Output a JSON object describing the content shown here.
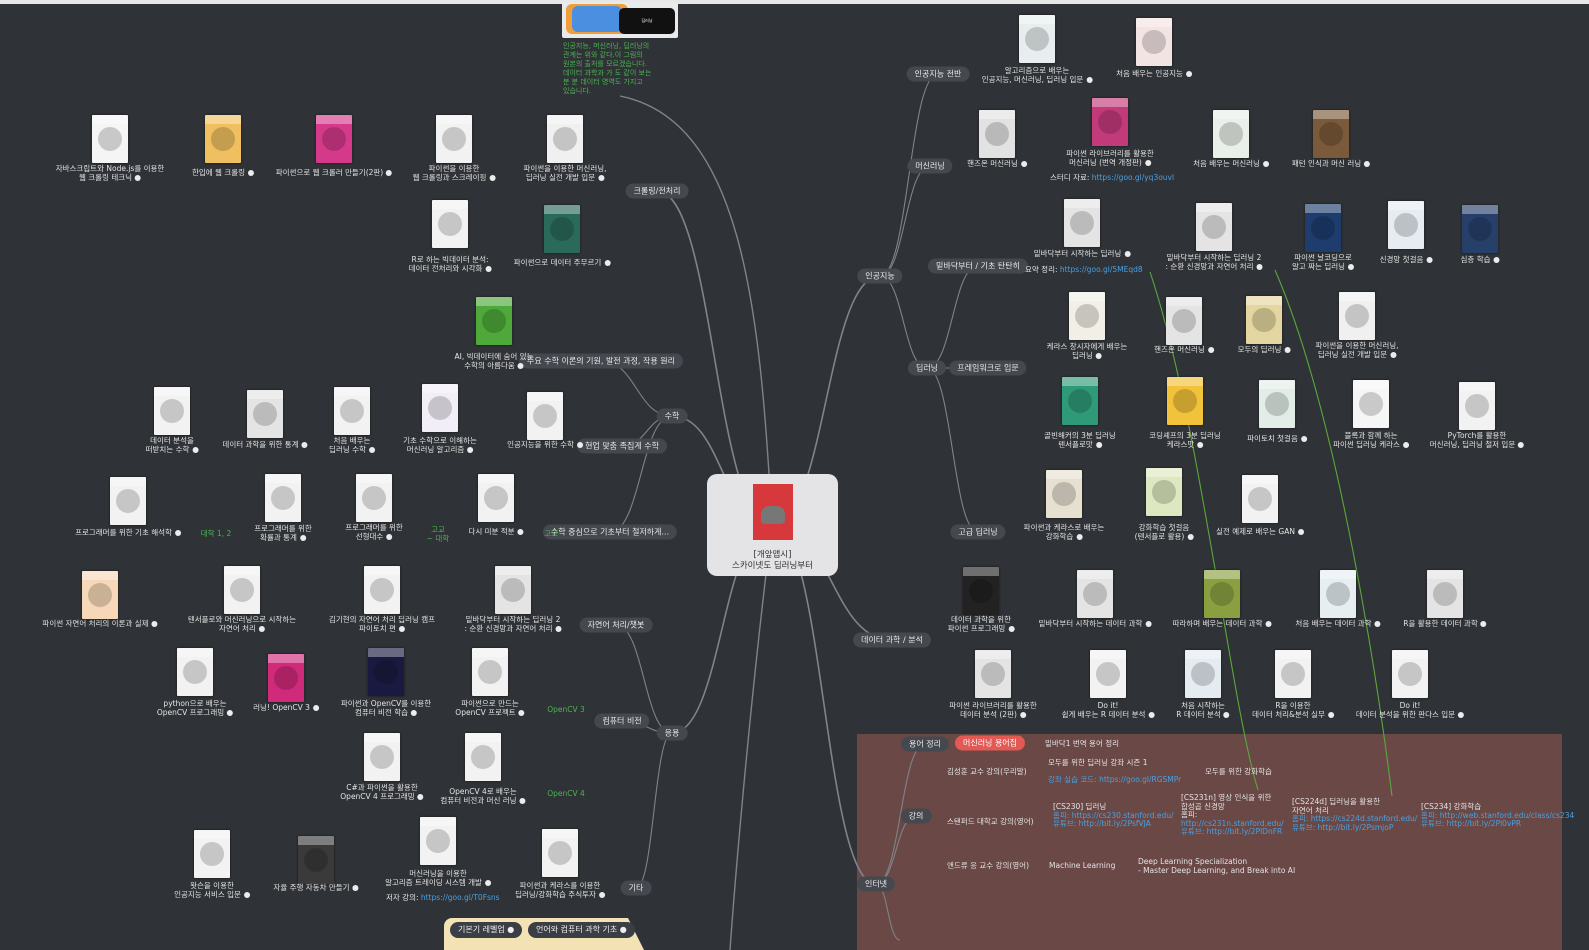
{
  "central": {
    "line1": "[개앞맵시]",
    "line2": "스카이넷도 딥러닝부터"
  },
  "top_note": {
    "image_labels": [
      "인공지능",
      "머신러닝",
      "딥러닝"
    ],
    "text": [
      "인공지능, 머신러닝, 딥러닝의",
      "관계는 위와 같다.이 그림의",
      "원본의 출처를 모르겠습니다.",
      "데이터 과학과 가 도 같이 보는",
      "분 분 데이터 영역도 가지고",
      "있습니다."
    ]
  },
  "branches": [
    {
      "id": "ai",
      "label": "인공지능"
    },
    {
      "id": "ds",
      "label": "데이터 과학 / 분석"
    },
    {
      "id": "internet",
      "label": "인터넷"
    },
    {
      "id": "crawl",
      "label": "크롤링/전처리"
    },
    {
      "id": "math",
      "label": "수학"
    },
    {
      "id": "app",
      "label": "응용"
    }
  ],
  "sub_pills": [
    {
      "label": "인공지능 전반"
    },
    {
      "label": "머신러닝"
    },
    {
      "label": "딥러닝"
    },
    {
      "label": "밑바닥부터 / 기초 탄탄히"
    },
    {
      "label": "프레임워크로 입문"
    },
    {
      "label": "고급 딥러닝"
    },
    {
      "label": "용어 정리"
    },
    {
      "label": "강의"
    },
    {
      "label": "주요 수학 이론의 기원, 발전 과정, 작용 원리"
    },
    {
      "label": "현업 맞춤 족집게 수학"
    },
    {
      "label": "수학 중심으로 기초부터 철저하게..."
    },
    {
      "label": "자연어 처리/챗봇"
    },
    {
      "label": "컴퓨터 비전"
    },
    {
      "label": "기타"
    }
  ],
  "books": [
    {
      "label": "알고리즘으로 배우는\n인공지능, 머신러닝, 딥러닝 입문",
      "color": "#e8eef0"
    },
    {
      "label": "처음 배우는 인공지능",
      "color": "#f3e4e4"
    },
    {
      "label": "핸즈온 머신러닝",
      "color": "#e2e2e2"
    },
    {
      "label": "파이썬 라이브러리를 활용한\n머신러닝 (번역 개정판)",
      "color": "#c23a7a"
    },
    {
      "label": "처음 배우는 머신러닝",
      "color": "#e9f0ea"
    },
    {
      "label": "패턴 인식과 머신 러닝",
      "color": "#7a5a3a"
    },
    {
      "label": "밑바닥부터 시작하는 딥러닝",
      "color": "#e4e4e4"
    },
    {
      "label": "밑바닥부터 시작하는 딥러닝 2\n: 순환 신경망과 자연어 처리",
      "color": "#e4e4e4"
    },
    {
      "label": "파이썬 날코딩으로\n알고 짜는 딥러닝",
      "color": "#1e3c6e"
    },
    {
      "label": "신경망 첫걸음",
      "color": "#e6ecf2"
    },
    {
      "label": "심층 학습",
      "color": "#27406a"
    },
    {
      "label": "케라스 창시자에게 배우는\n딥러닝",
      "color": "#f2f0e6"
    },
    {
      "label": "핸즈온 머신러닝",
      "color": "#e4e4e4"
    },
    {
      "label": "모두의 딥러닝",
      "color": "#e3d6a0"
    },
    {
      "label": "파이썬을 이용한 머신러닝,\n딥러닝 실전 개발 입문",
      "color": "#f0f0f0"
    },
    {
      "label": "골빈해커의 3분 딥러닝\n텐서플로맛",
      "color": "#2e9a78"
    },
    {
      "label": "코딩셰프의 3분 딥러닝\n케라스맛",
      "color": "#f2c23a"
    },
    {
      "label": "파이토치 첫걸음",
      "color": "#e3ede8"
    },
    {
      "label": "블록과 함께 하는\n파이썬 딥러닝 케라스",
      "color": "#f6f6f6"
    },
    {
      "label": "PyTorch를 활용한\n머신러닝, 딥러닝 철저 입문",
      "color": "#f2f2f2"
    },
    {
      "label": "파이썬과 케라스로 배우는\n강화학습",
      "color": "#e6e0d0"
    },
    {
      "label": "강화학습 첫걸음\n(텐서플로 활용)",
      "color": "#dde8c0"
    },
    {
      "label": "실전 예제로 배우는 GAN",
      "color": "#f2f2f2"
    },
    {
      "label": "데이터 과학을 위한\n파이썬 프로그래밍",
      "color": "#222222"
    },
    {
      "label": "밑바닥부터 시작하는 데이터 과학",
      "color": "#e4e4e4"
    },
    {
      "label": "따라하며 배우는 데이터 과학",
      "color": "#8aa040"
    },
    {
      "label": "처음 배우는 데이터 과학",
      "color": "#e6eef2"
    },
    {
      "label": "R을 활용한 데이터 과학",
      "color": "#e4e4e4"
    },
    {
      "label": "파이썬 라이브러리를 활용한\n데이터 분석 (2판)",
      "color": "#e4e4e4"
    },
    {
      "label": "Do it!\n쉽게 배우는 R 데이터 분석",
      "color": "#f2f2f2"
    },
    {
      "label": "처음 시작하는\nR 데이터 분석",
      "color": "#e4ecf2"
    },
    {
      "label": "R을 이용한\n데이터 처리&분석 실무",
      "color": "#f2f2f2"
    },
    {
      "label": "Do it!\n데이터 분석을 위한 판다스 입문",
      "color": "#f2f2f2"
    },
    {
      "label": "자바스크립트와 Node.js를 이용한\n웹 크롤링 테크닉",
      "color": "#f5f5f5"
    },
    {
      "label": "한입에 웹 크롤링",
      "color": "#f0c060"
    },
    {
      "label": "파이썬으로 웹 크롤러 만들기(2판)",
      "color": "#d53a8a"
    },
    {
      "label": "파이썬을 이용한\n웹 크롤링과 스크레이핑",
      "color": "#f2f2f2"
    },
    {
      "label": "파이썬을 이용한 머신러닝,\n딥러닝 실전 개발 입문",
      "color": "#f0f0f0"
    },
    {
      "label": "R로 하는 빅데이터 분석:\n데이터 전처리와 시각화",
      "color": "#f2f2f2"
    },
    {
      "label": "파이썬으로 데이터 주무르기",
      "color": "#2a6a5a"
    },
    {
      "label": "AI, 빅데이터에 숨어 있는\n수학의 아름다움",
      "color": "#4ea83a"
    },
    {
      "label": "데이터 분석을\n떠받치는 수학",
      "color": "#f2f2f2"
    },
    {
      "label": "데이터 과학을 위한 통계",
      "color": "#e4e4e4"
    },
    {
      "label": "처음 배우는\n딥러닝 수학",
      "color": "#f2f2f2"
    },
    {
      "label": "기초 수학으로 이해하는\n머신러닝 알고리즘",
      "color": "#f2eef8"
    },
    {
      "label": "인공지능을 위한 수학",
      "color": "#f2f2f2"
    },
    {
      "label": "프로그래머를 위한 기초 해석학",
      "color": "#f2f2f2"
    },
    {
      "label": "프로그래머를 위한\n확률과 통계",
      "color": "#f2f2f2"
    },
    {
      "label": "프로그래머를 위한\n선형대수",
      "color": "#f2f2f2"
    },
    {
      "label": "다시 미분 적분",
      "color": "#f2f2f2"
    },
    {
      "label": "파이썬 자연어 처리의 이론과 실제",
      "color": "#f6d8b8"
    },
    {
      "label": "텐서플로와 머신러닝으로 시작하는\n자연어 처리",
      "color": "#f2f2f2"
    },
    {
      "label": "김기현의 자연어 처리 딥러닝 캠프\n파이토치 편",
      "color": "#f2f2f2"
    },
    {
      "label": "밑바닥부터 시작하는 딥러닝 2\n: 순환 신경망과 자연어 처리",
      "color": "#e4e4e4"
    },
    {
      "label": "python으로 배우는\nOpenCV 프로그래밍",
      "color": "#f2f2f2"
    },
    {
      "label": "러닝! OpenCV 3",
      "color": "#d02a7a"
    },
    {
      "label": "파이썬과 OpenCV를 이용한\n컴퓨터 비전 학습",
      "color": "#1a1a40"
    },
    {
      "label": "파이썬으로 만드는\nOpenCV 프로젝트",
      "color": "#f2f2f2"
    },
    {
      "label": "C#과 파이썬을 활용한\nOpenCV 4 프로그래밍",
      "color": "#f2f2f2"
    },
    {
      "label": "OpenCV 4로 배우는\n컴퓨터 비전과 머신 러닝",
      "color": "#f2f2f2"
    },
    {
      "label": "왓슨을 이용한\n인공지능 서비스 입문",
      "color": "#f2f2f2"
    },
    {
      "label": "자율 주행 자동차 만들기",
      "color": "#3a3a3a"
    },
    {
      "label": "머신러닝을 이용한\n알고리즘 트레이딩 시스템 개발",
      "color": "#f2f2f2"
    },
    {
      "label": "파이썬과 케라스를 이용한\n딥러닝/강화학습 주식투자",
      "color": "#f2f2f2"
    }
  ],
  "plain_labels": [
    {
      "text": "스터디 자료: ",
      "link": "https://goo.gl/yq3ouvl"
    },
    {
      "text": "요약 정리: ",
      "link": "https://goo.gl/5MEqd8"
    },
    {
      "text": "저자 강의: ",
      "link": "https://goo.gl/T0Fsns"
    }
  ],
  "green_labels": [
    "대학 1, 2",
    "고교\n~ 대학",
    "고교",
    "OpenCV 3",
    "OpenCV 4"
  ],
  "internet": {
    "terms": {
      "red_pill": "머신러닝 용어집",
      "item": "밑바닥1 번역 용어 정리"
    },
    "lectures": [
      {
        "group": "김성훈 교수 강의(우리말)",
        "items": [
          {
            "title": "모두를 위한 딥러닝 강좌 시즌 1",
            "lines": []
          },
          {
            "title": "모두를 위한 강화학습",
            "lines": []
          },
          {
            "title": "강좌 실습 코드: https://goo.gl/RGSMPr",
            "lines": []
          }
        ]
      },
      {
        "group": "스탠퍼드 대학교 강의(영어)",
        "items": [
          {
            "title": "[CS230] 딥러닝",
            "lines": [
              "홈피: https://cs230.stanford.edu/",
              "유튜브: http://bit.ly/2PsfVJA"
            ]
          },
          {
            "title": "[CS231n] 영상 인식을 위한\n합성곱 신경망",
            "lines": [
              "홈피:",
              "http://cs231n.stanford.edu/",
              "유튜브: http://bit.ly/2PlDnFR"
            ]
          },
          {
            "title": "[CS224d] 딥러닝을 활용한\n자연어 처리",
            "lines": [
              "홈피: https://cs224d.stanford.edu/",
              "유튜브: http://bit.ly/2PsmjoP"
            ]
          },
          {
            "title": "[CS234] 강화학습",
            "lines": [
              "홈피: http://web.stanford.edu/class/cs234",
              "유튜브: http://bit.ly/2Pl0vPR"
            ]
          }
        ]
      },
      {
        "group": "앤드류 응 교수 강의(영어)",
        "items": [
          {
            "title": "Machine Learning",
            "lines": []
          },
          {
            "title": "Deep Learning Specialization\n- Master Deep Learning, and Break into AI",
            "lines": []
          }
        ]
      }
    ]
  },
  "bottom_tabs": [
    "기본기 레벨업",
    "언어와 컴퓨터 과학 기초"
  ],
  "colors": {
    "background": "#2f3236",
    "pill": "#45494f",
    "line": "#7f848a",
    "red_pill": "#e35a55",
    "internet_box": "#6a4846",
    "green_text": "#4bb451",
    "link": "#4aa0e0"
  }
}
